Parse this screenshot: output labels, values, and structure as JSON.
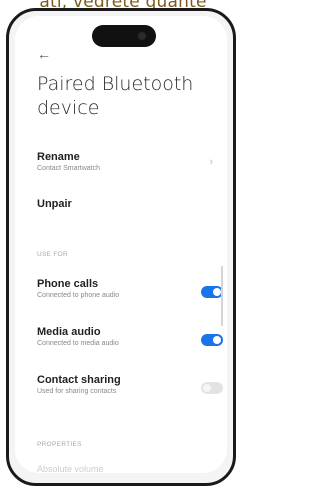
{
  "caption": "ati, vedrete quante",
  "header": {
    "back_icon": "←",
    "title": "Paired Bluetooth device"
  },
  "device": {
    "rename_label": "Rename",
    "rename_value": "Contact Smartwatch",
    "unpair_label": "Unpair"
  },
  "use_for": {
    "section_title": "USE FOR",
    "items": [
      {
        "label": "Phone calls",
        "sub": "Connected to phone audio",
        "enabled": true
      },
      {
        "label": "Media audio",
        "sub": "Connected to media audio",
        "enabled": true
      },
      {
        "label": "Contact sharing",
        "sub": "Used for sharing contacts",
        "enabled": false
      }
    ]
  },
  "properties": {
    "section_title": "PROPERTIES",
    "partial_item": "Absolute volume"
  },
  "colors": {
    "accent": "#1a73e8",
    "toggle_off": "#e3e3e3"
  }
}
